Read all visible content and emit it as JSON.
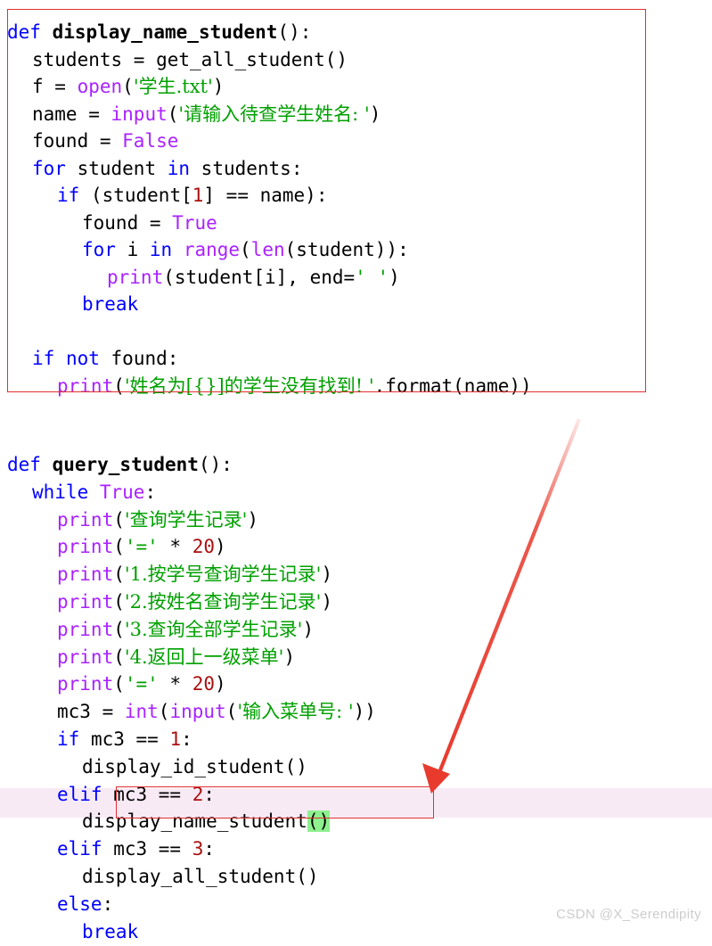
{
  "watermark": {
    "text": "CSDN @X_Serendipity"
  },
  "colors": {
    "keyword": "#0000ff",
    "builtin": "#aa22ff",
    "string": "#00a000",
    "number": "#aa1111",
    "constant": "#aa22ff",
    "plain": "#000000",
    "box_border": "#e03030",
    "selected_row_bg": "#f8eaf5",
    "green_highlight": "#8ef08e",
    "arrow": "#e83b2e",
    "watermark": "#cccccc",
    "background": "#ffffff"
  },
  "annotations": {
    "outer_box_label": "red rectangle around display_name_student definition",
    "call_box_label": "red rectangle around display_name_student() call",
    "arrow_label": "red arrow from definition block to highlighted call"
  },
  "code_block_1": {
    "title": "display_name_student",
    "lines": [
      {
        "indent": 0,
        "tokens": [
          {
            "t": "def ",
            "c": "kw"
          },
          {
            "t": "display_name_student",
            "c": "fn"
          },
          {
            "t": "():",
            "c": "pn"
          }
        ]
      },
      {
        "indent": 1,
        "tokens": [
          {
            "t": "students = get_all_student()",
            "c": "pn"
          }
        ]
      },
      {
        "indent": 1,
        "tokens": [
          {
            "t": "f = ",
            "c": "pn"
          },
          {
            "t": "open",
            "c": "bi"
          },
          {
            "t": "(",
            "c": "pn"
          },
          {
            "t": "'学生.txt'",
            "c": "str"
          },
          {
            "t": ")",
            "c": "pn"
          }
        ]
      },
      {
        "indent": 1,
        "tokens": [
          {
            "t": "name = ",
            "c": "pn"
          },
          {
            "t": "input",
            "c": "bi"
          },
          {
            "t": "(",
            "c": "pn"
          },
          {
            "t": "'请输入待查学生姓名: '",
            "c": "str"
          },
          {
            "t": ")",
            "c": "pn"
          }
        ]
      },
      {
        "indent": 1,
        "tokens": [
          {
            "t": "found = ",
            "c": "pn"
          },
          {
            "t": "False",
            "c": "const"
          }
        ]
      },
      {
        "indent": 1,
        "tokens": [
          {
            "t": "for",
            "c": "kw"
          },
          {
            "t": " student ",
            "c": "pn"
          },
          {
            "t": "in",
            "c": "kw"
          },
          {
            "t": " students:",
            "c": "pn"
          }
        ]
      },
      {
        "indent": 2,
        "tokens": [
          {
            "t": "if",
            "c": "kw"
          },
          {
            "t": " (student[",
            "c": "pn"
          },
          {
            "t": "1",
            "c": "num"
          },
          {
            "t": "] == name):",
            "c": "pn"
          }
        ]
      },
      {
        "indent": 3,
        "tokens": [
          {
            "t": "found = ",
            "c": "pn"
          },
          {
            "t": "True",
            "c": "const"
          }
        ]
      },
      {
        "indent": 3,
        "tokens": [
          {
            "t": "for",
            "c": "kw"
          },
          {
            "t": " i ",
            "c": "pn"
          },
          {
            "t": "in",
            "c": "kw"
          },
          {
            "t": " ",
            "c": "pn"
          },
          {
            "t": "range",
            "c": "bi"
          },
          {
            "t": "(",
            "c": "pn"
          },
          {
            "t": "len",
            "c": "bi"
          },
          {
            "t": "(student)):",
            "c": "pn"
          }
        ]
      },
      {
        "indent": 4,
        "tokens": [
          {
            "t": "print",
            "c": "bi"
          },
          {
            "t": "(student[i], end=",
            "c": "pn"
          },
          {
            "t": "' '",
            "c": "str"
          },
          {
            "t": ")",
            "c": "pn"
          }
        ]
      },
      {
        "indent": 3,
        "tokens": [
          {
            "t": "break",
            "c": "kw"
          }
        ]
      },
      {
        "indent": 0,
        "tokens": []
      },
      {
        "indent": 1,
        "tokens": [
          {
            "t": "if",
            "c": "kw"
          },
          {
            "t": " ",
            "c": "pn"
          },
          {
            "t": "not",
            "c": "kw"
          },
          {
            "t": " found:",
            "c": "pn"
          }
        ]
      },
      {
        "indent": 2,
        "tokens": [
          {
            "t": "print",
            "c": "bi"
          },
          {
            "t": "(",
            "c": "pn"
          },
          {
            "t": "'姓名为[{}]的学生没有找到! '",
            "c": "str"
          },
          {
            "t": ".format(name))",
            "c": "pn"
          }
        ]
      }
    ]
  },
  "code_block_2": {
    "title": "query_student",
    "lines": [
      {
        "indent": 0,
        "tokens": [
          {
            "t": "def ",
            "c": "kw"
          },
          {
            "t": "query_student",
            "c": "fn"
          },
          {
            "t": "():",
            "c": "pn"
          }
        ]
      },
      {
        "indent": 1,
        "tokens": [
          {
            "t": "while",
            "c": "kw"
          },
          {
            "t": " ",
            "c": "pn"
          },
          {
            "t": "True",
            "c": "const"
          },
          {
            "t": ":",
            "c": "pn"
          }
        ]
      },
      {
        "indent": 2,
        "tokens": [
          {
            "t": "print",
            "c": "bi"
          },
          {
            "t": "(",
            "c": "pn"
          },
          {
            "t": "'查询学生记录'",
            "c": "str"
          },
          {
            "t": ")",
            "c": "pn"
          }
        ]
      },
      {
        "indent": 2,
        "tokens": [
          {
            "t": "print",
            "c": "bi"
          },
          {
            "t": "(",
            "c": "pn"
          },
          {
            "t": "'='",
            "c": "str"
          },
          {
            "t": " * ",
            "c": "pn"
          },
          {
            "t": "20",
            "c": "num"
          },
          {
            "t": ")",
            "c": "pn"
          }
        ]
      },
      {
        "indent": 2,
        "tokens": [
          {
            "t": "print",
            "c": "bi"
          },
          {
            "t": "(",
            "c": "pn"
          },
          {
            "t": "'1.按学号查询学生记录'",
            "c": "str"
          },
          {
            "t": ")",
            "c": "pn"
          }
        ]
      },
      {
        "indent": 2,
        "tokens": [
          {
            "t": "print",
            "c": "bi"
          },
          {
            "t": "(",
            "c": "pn"
          },
          {
            "t": "'2.按姓名查询学生记录'",
            "c": "str"
          },
          {
            "t": ")",
            "c": "pn"
          }
        ]
      },
      {
        "indent": 2,
        "tokens": [
          {
            "t": "print",
            "c": "bi"
          },
          {
            "t": "(",
            "c": "pn"
          },
          {
            "t": "'3.查询全部学生记录'",
            "c": "str"
          },
          {
            "t": ")",
            "c": "pn"
          }
        ]
      },
      {
        "indent": 2,
        "tokens": [
          {
            "t": "print",
            "c": "bi"
          },
          {
            "t": "(",
            "c": "pn"
          },
          {
            "t": "'4.返回上一级菜单'",
            "c": "str"
          },
          {
            "t": ")",
            "c": "pn"
          }
        ]
      },
      {
        "indent": 2,
        "tokens": [
          {
            "t": "print",
            "c": "bi"
          },
          {
            "t": "(",
            "c": "pn"
          },
          {
            "t": "'='",
            "c": "str"
          },
          {
            "t": " * ",
            "c": "pn"
          },
          {
            "t": "20",
            "c": "num"
          },
          {
            "t": ")",
            "c": "pn"
          }
        ]
      },
      {
        "indent": 2,
        "tokens": [
          {
            "t": "mc3 = ",
            "c": "pn"
          },
          {
            "t": "int",
            "c": "bi"
          },
          {
            "t": "(",
            "c": "pn"
          },
          {
            "t": "input",
            "c": "bi"
          },
          {
            "t": "(",
            "c": "pn"
          },
          {
            "t": "'输入菜单号: '",
            "c": "str"
          },
          {
            "t": "))",
            "c": "pn"
          }
        ]
      },
      {
        "indent": 2,
        "tokens": [
          {
            "t": "if",
            "c": "kw"
          },
          {
            "t": " mc3 == ",
            "c": "pn"
          },
          {
            "t": "1",
            "c": "num"
          },
          {
            "t": ":",
            "c": "pn"
          }
        ]
      },
      {
        "indent": 3,
        "tokens": [
          {
            "t": "display_id_student()",
            "c": "pn"
          }
        ]
      },
      {
        "indent": 2,
        "tokens": [
          {
            "t": "elif",
            "c": "kw"
          },
          {
            "t": " mc3 == ",
            "c": "pn"
          },
          {
            "t": "2",
            "c": "num"
          },
          {
            "t": ":",
            "c": "pn"
          }
        ]
      },
      {
        "indent": 3,
        "selected": true,
        "tokens": [
          {
            "t": "display_name_student",
            "c": "pn"
          },
          {
            "t": "()",
            "c": "pn",
            "hl": "green"
          }
        ]
      },
      {
        "indent": 2,
        "tokens": [
          {
            "t": "elif",
            "c": "kw"
          },
          {
            "t": " mc3 == ",
            "c": "pn"
          },
          {
            "t": "3",
            "c": "num"
          },
          {
            "t": ":",
            "c": "pn"
          }
        ]
      },
      {
        "indent": 3,
        "tokens": [
          {
            "t": "display_all_student()",
            "c": "pn"
          }
        ]
      },
      {
        "indent": 2,
        "tokens": [
          {
            "t": "else",
            "c": "kw"
          },
          {
            "t": ":",
            "c": "pn"
          }
        ]
      },
      {
        "indent": 3,
        "tokens": [
          {
            "t": "break",
            "c": "kw"
          }
        ]
      }
    ]
  }
}
